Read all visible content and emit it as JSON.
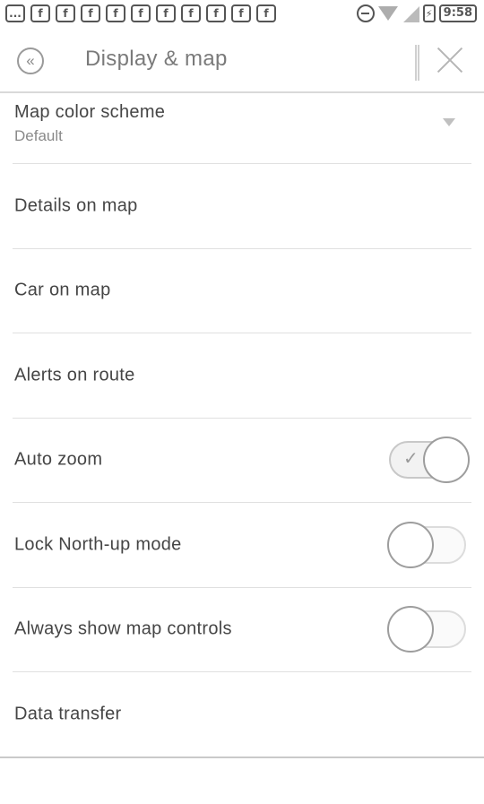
{
  "status_bar": {
    "left_icons": [
      "...",
      "f",
      "f",
      "f",
      "f",
      "f",
      "f",
      "f",
      "f",
      "f",
      "f"
    ],
    "time": "9:58"
  },
  "header": {
    "title": "Display & map"
  },
  "settings": {
    "map_color_scheme": {
      "label": "Map color scheme",
      "value": "Default"
    },
    "details_on_map": {
      "label": "Details on map"
    },
    "car_on_map": {
      "label": "Car on map"
    },
    "alerts_on_route": {
      "label": "Alerts on route"
    },
    "auto_zoom": {
      "label": "Auto zoom",
      "enabled": true
    },
    "lock_north_up": {
      "label": "Lock North-up mode",
      "enabled": false
    },
    "always_show_controls": {
      "label": "Always show map controls",
      "enabled": false
    },
    "data_transfer": {
      "label": "Data transfer"
    }
  }
}
